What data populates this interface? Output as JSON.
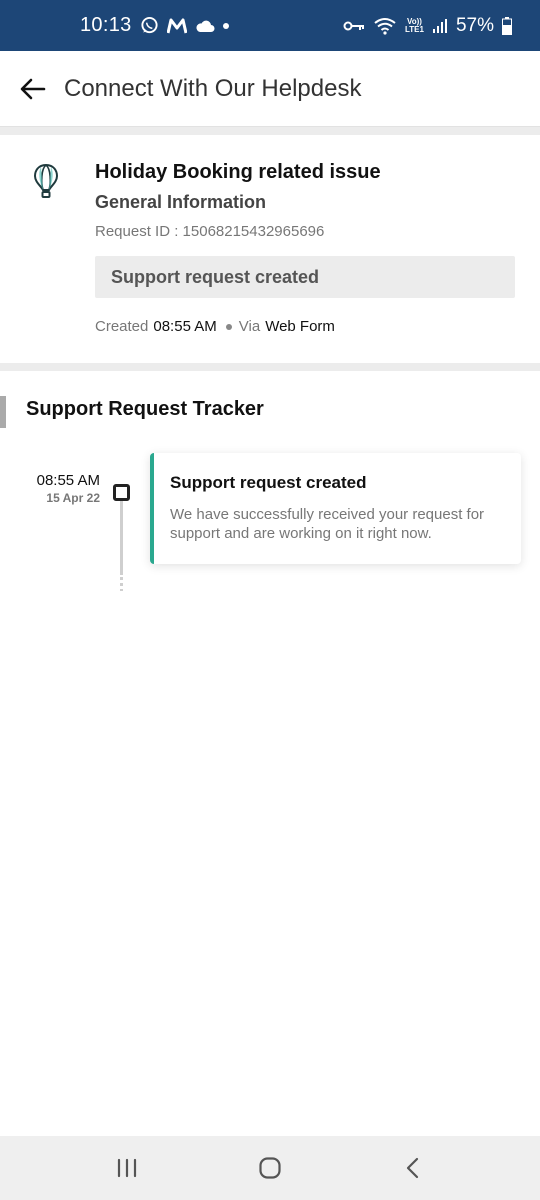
{
  "status_bar": {
    "time": "10:13",
    "volte_top": "Vo))",
    "volte_bottom": "LTE1",
    "battery": "57%"
  },
  "app_bar": {
    "title": "Connect With Our Helpdesk"
  },
  "info_card": {
    "title": "Holiday Booking related issue",
    "subtitle": "General Information",
    "request_id": "Request ID : 15068215432965696",
    "status": "Support request created",
    "created_label": "Created",
    "created_time": "08:55 AM",
    "via_label": "Via",
    "via_value": "Web Form"
  },
  "tracker": {
    "title": "Support Request Tracker",
    "events": [
      {
        "time": "08:55 AM",
        "date": "15 Apr 22",
        "title": "Support request created",
        "description": "We have successfully received your request for support and are working on it right now."
      }
    ]
  },
  "colors": {
    "status_bar_bg": "#1d4677",
    "accent_teal": "#2aa88f",
    "chip_bg": "#ececec"
  },
  "icons": {
    "back": "arrow-left-icon",
    "category": "hot-air-balloon-icon",
    "nav_recents": "recents-icon",
    "nav_home": "home-icon",
    "nav_back": "chevron-left-icon"
  }
}
